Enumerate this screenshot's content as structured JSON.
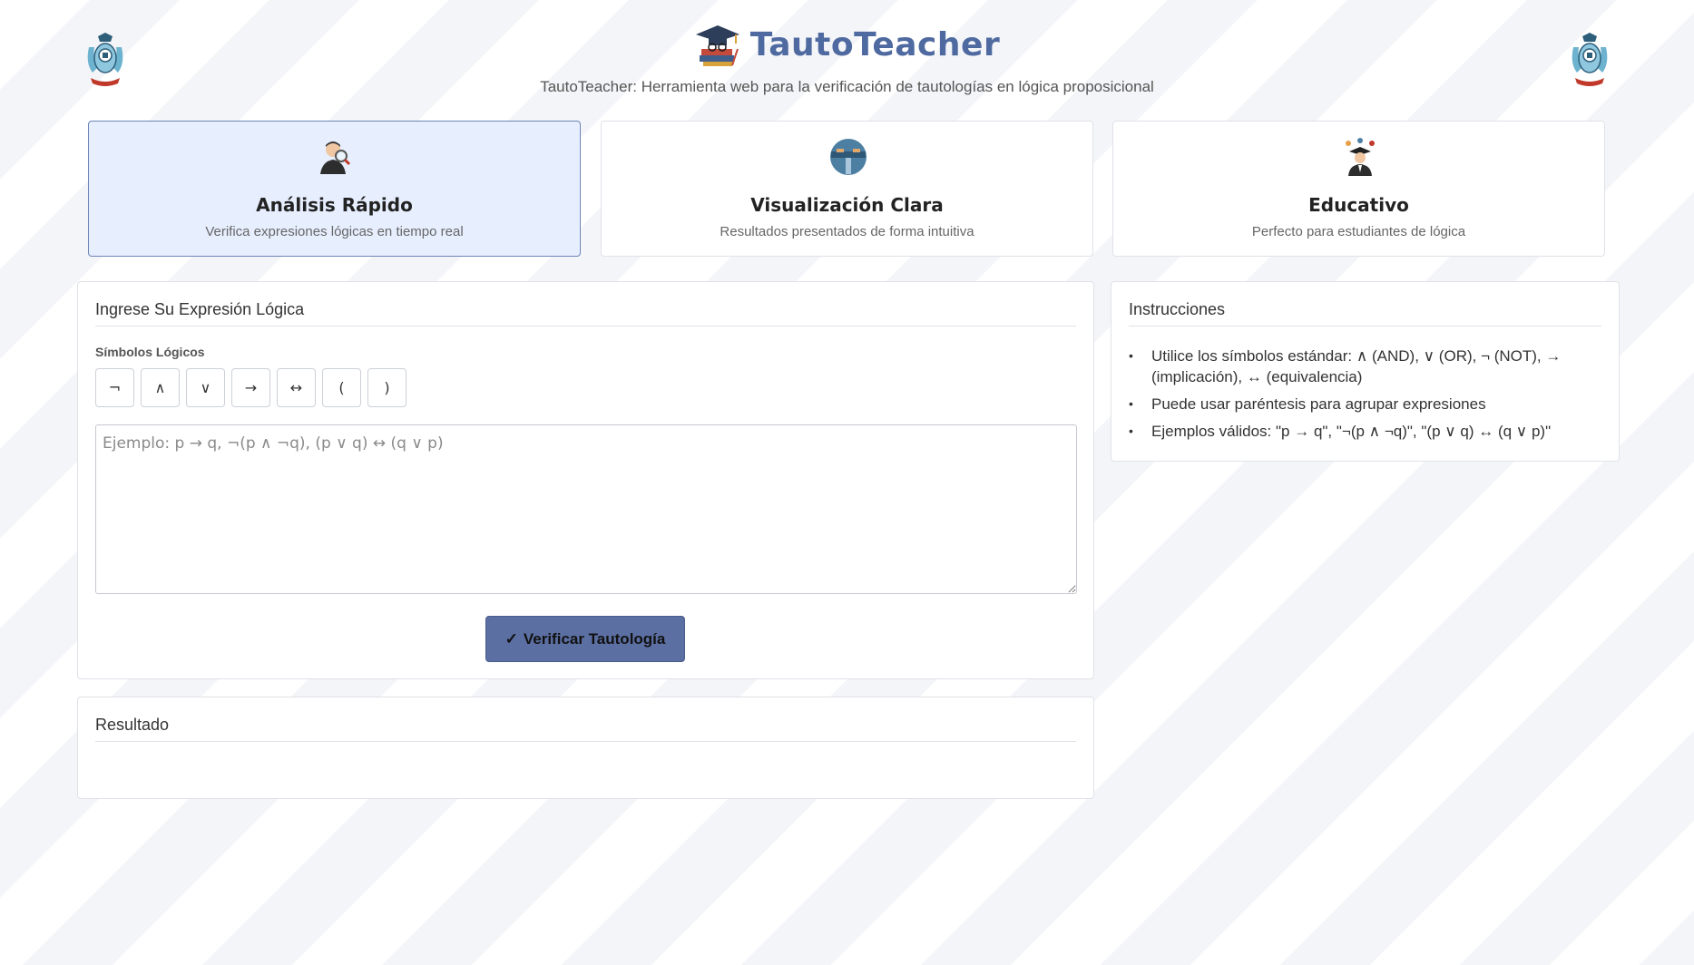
{
  "header": {
    "title": "TautoTeacher",
    "subtitle": "TautoTeacher: Herramienta web para la verificación de tautologías en lógica proposicional",
    "logo_icon": "university-crest-icon",
    "brand_icon": "graduation-cap-books-icon"
  },
  "features": [
    {
      "title": "Análisis Rápido",
      "description": "Verifica expresiones lógicas en tiempo real",
      "icon": "magnifier-person-icon",
      "active": true
    },
    {
      "title": "Visualización Clara",
      "description": "Resultados presentados de forma intuitiva",
      "icon": "globe-view-icon",
      "active": false
    },
    {
      "title": "Educativo",
      "description": "Perfecto para estudiantes de lógica",
      "icon": "graduate-person-icon",
      "active": false
    }
  ],
  "input_panel": {
    "title": "Ingrese Su Expresión Lógica",
    "symbols_label": "Símbolos Lógicos",
    "symbols": [
      "¬",
      "∧",
      "∨",
      "→",
      "↔",
      "(",
      ")"
    ],
    "expression_value": "",
    "expression_placeholder": "Ejemplo: p → q, ¬(p ∧ ¬q), (p ∨ q) ↔ (q ∨ p)",
    "verify_button": "Verificar Tautología",
    "verify_icon": "check-icon"
  },
  "result_panel": {
    "title": "Resultado"
  },
  "instructions_panel": {
    "title": "Instrucciones",
    "items": [
      "Utilice los símbolos estándar: ∧ (AND), ∨ (OR), ¬ (NOT), → (implicación), ↔ (equivalencia)",
      "Puede usar paréntesis para agrupar expresiones",
      "Ejemplos válidos: \"p → q\", \"¬(p ∧ ¬q)\", \"(p ∨ q) ↔ (q ∨ p)\""
    ]
  },
  "colors": {
    "brand": "#4f6aa0",
    "button": "#5b6fa3",
    "active_card": "#e7efff"
  }
}
